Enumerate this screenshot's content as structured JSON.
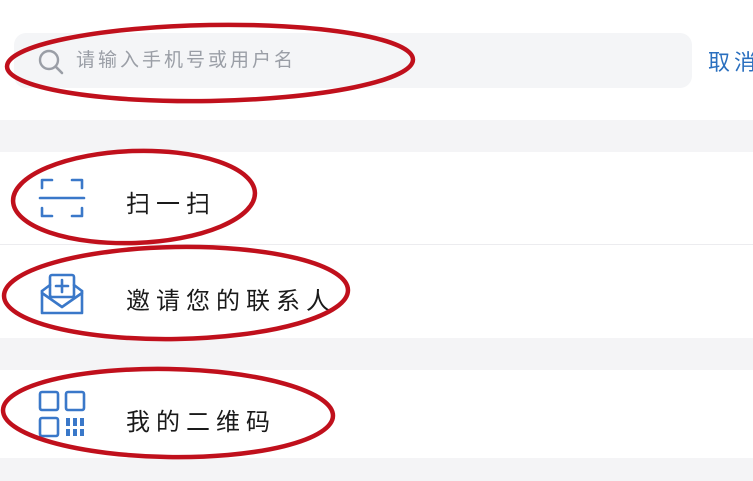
{
  "search": {
    "placeholder": "请输入手机号或用户名",
    "value": "",
    "cancel_label": "取消"
  },
  "menu": {
    "items": [
      {
        "id": "scan",
        "label": "扫一扫",
        "icon": "scan-icon"
      },
      {
        "id": "invite",
        "label": "邀请您的联系人",
        "icon": "envelope-plus-icon"
      },
      {
        "id": "qr",
        "label": "我的二维码",
        "icon": "qr-code-icon"
      }
    ]
  },
  "colors": {
    "accent": "#2a6fbf",
    "icon": "#3a78c9",
    "annotation": "#c0101c",
    "band": "#f4f4f6",
    "search_bg": "#f4f5f7"
  }
}
